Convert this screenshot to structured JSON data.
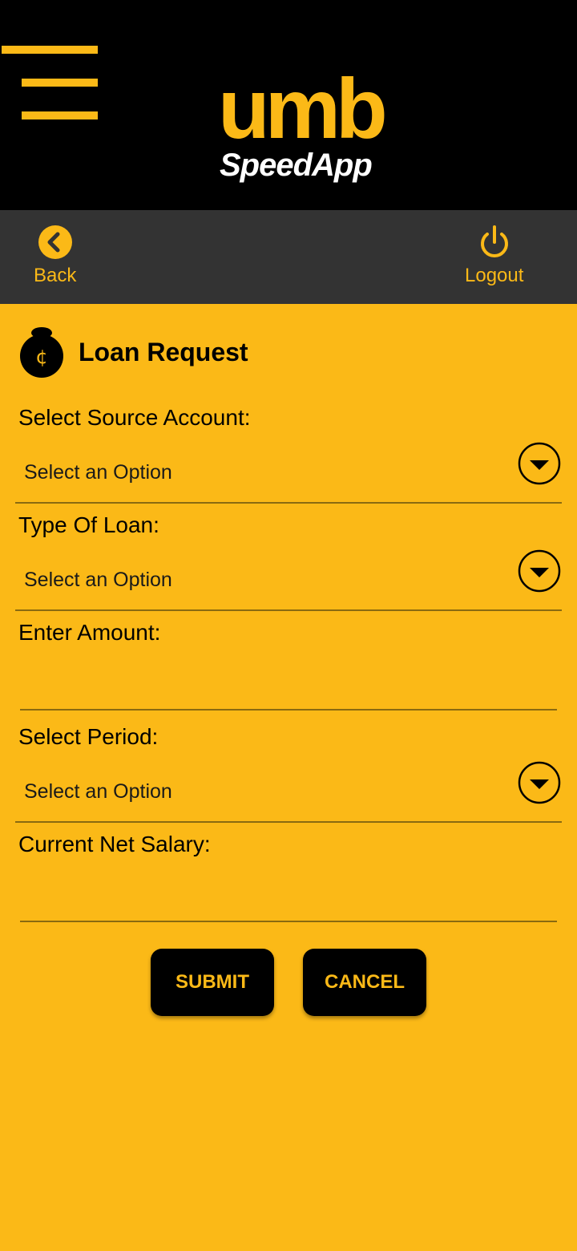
{
  "header": {
    "logo_main": "umb",
    "logo_sub": "SpeedApp"
  },
  "nav": {
    "back_label": "Back",
    "logout_label": "Logout"
  },
  "page": {
    "title": "Loan Request",
    "icon": "money-bag-icon"
  },
  "form": {
    "source_account_label": "Select Source Account:",
    "source_account_value": "Select an Option",
    "loan_type_label": "Type Of Loan:",
    "loan_type_value": "Select an Option",
    "amount_label": "Enter Amount:",
    "amount_value": "",
    "period_label": "Select Period:",
    "period_value": "Select an Option",
    "salary_label": "Current Net Salary:",
    "salary_value": ""
  },
  "buttons": {
    "submit": "SUBMIT",
    "cancel": "CANCEL"
  },
  "colors": {
    "accent": "#FBB917",
    "topbar": "#000000",
    "navbar": "#333333"
  }
}
